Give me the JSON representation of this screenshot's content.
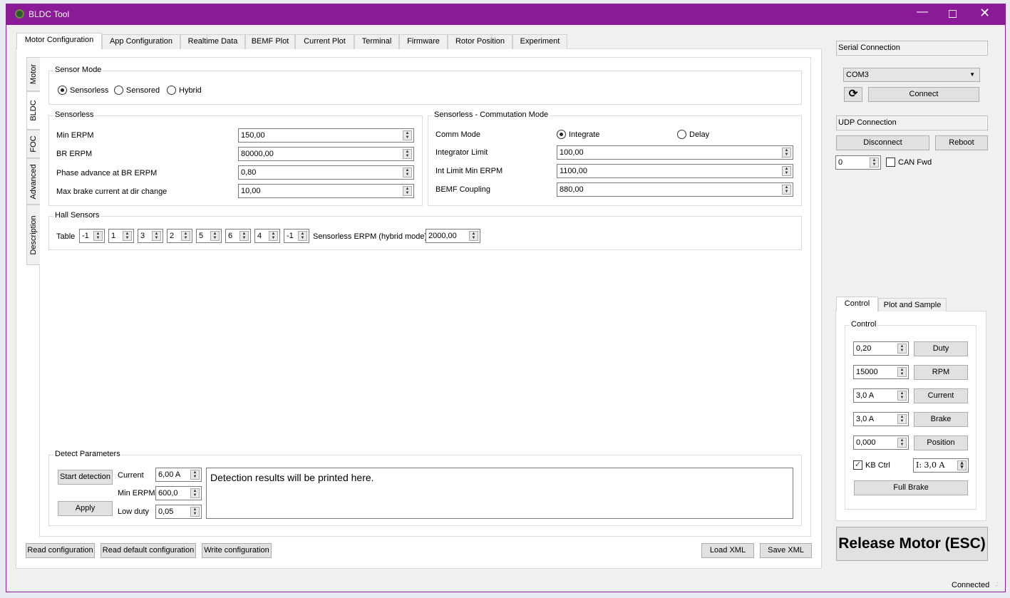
{
  "window": {
    "title": "BLDC Tool"
  },
  "tabs": [
    "Motor Configuration",
    "App Configuration",
    "Realtime Data",
    "BEMF Plot",
    "Current Plot",
    "Terminal",
    "Firmware",
    "Rotor Position",
    "Experiment"
  ],
  "vtabs": [
    "Motor",
    "BLDC",
    "FOC",
    "Advanced",
    "Description"
  ],
  "sensor_mode": {
    "title": "Sensor Mode",
    "options": [
      "Sensorless",
      "Sensored",
      "Hybrid"
    ],
    "selected": "Sensorless"
  },
  "sensorless": {
    "title": "Sensorless",
    "rows": [
      {
        "label": "Min ERPM",
        "value": "150,00"
      },
      {
        "label": "BR ERPM",
        "value": "80000,00"
      },
      {
        "label": "Phase advance at BR ERPM",
        "value": "0,80"
      },
      {
        "label": "Max brake current at dir change",
        "value": "10,00"
      }
    ]
  },
  "commutation": {
    "title": "Sensorless - Commutation Mode",
    "comm_mode_label": "Comm Mode",
    "options": [
      "Integrate",
      "Delay"
    ],
    "selected": "Integrate",
    "rows": [
      {
        "label": "Integrator Limit",
        "value": "100,00"
      },
      {
        "label": "Int Limit Min ERPM",
        "value": "1100,00"
      },
      {
        "label": "BEMF Coupling",
        "value": "880,00"
      }
    ]
  },
  "hall": {
    "title": "Hall Sensors",
    "table_label": "Table",
    "table": [
      "-1",
      "1",
      "3",
      "2",
      "5",
      "6",
      "4",
      "-1"
    ],
    "erpm_label": "Sensorless ERPM (hybrid mode)",
    "erpm_value": "2000,00"
  },
  "detect": {
    "title": "Detect Parameters",
    "start": "Start detection",
    "apply": "Apply",
    "current_label": "Current",
    "current": "6,00 A",
    "min_erpm_label": "Min ERPM",
    "min_erpm": "600,0",
    "low_duty_label": "Low duty",
    "low_duty": "0,05",
    "results": "Detection results will be printed here."
  },
  "bottom": {
    "read": "Read configuration",
    "read_default": "Read default configuration",
    "write": "Write configuration",
    "load_xml": "Load XML",
    "save_xml": "Save XML"
  },
  "serial": {
    "title": "Serial Connection",
    "port": "COM3",
    "connect": "Connect"
  },
  "udp": {
    "title": "UDP Connection",
    "disconnect": "Disconnect",
    "reboot": "Reboot",
    "can_id": "0",
    "can_fwd": "CAN Fwd"
  },
  "control": {
    "tabs": [
      "Control",
      "Plot and Sample"
    ],
    "group": "Control",
    "rows": [
      {
        "value": "0,20",
        "button": "Duty"
      },
      {
        "value": "15000",
        "button": "RPM"
      },
      {
        "value": "3,0 A",
        "button": "Current"
      },
      {
        "value": "3,0 A",
        "button": "Brake"
      },
      {
        "value": "0,000",
        "button": "Position"
      }
    ],
    "kb_ctrl": "KB Ctrl",
    "kb_current": "I: 3,0 A",
    "full_brake": "Full Brake",
    "release": "Release Motor (ESC)"
  },
  "status": "Connected"
}
